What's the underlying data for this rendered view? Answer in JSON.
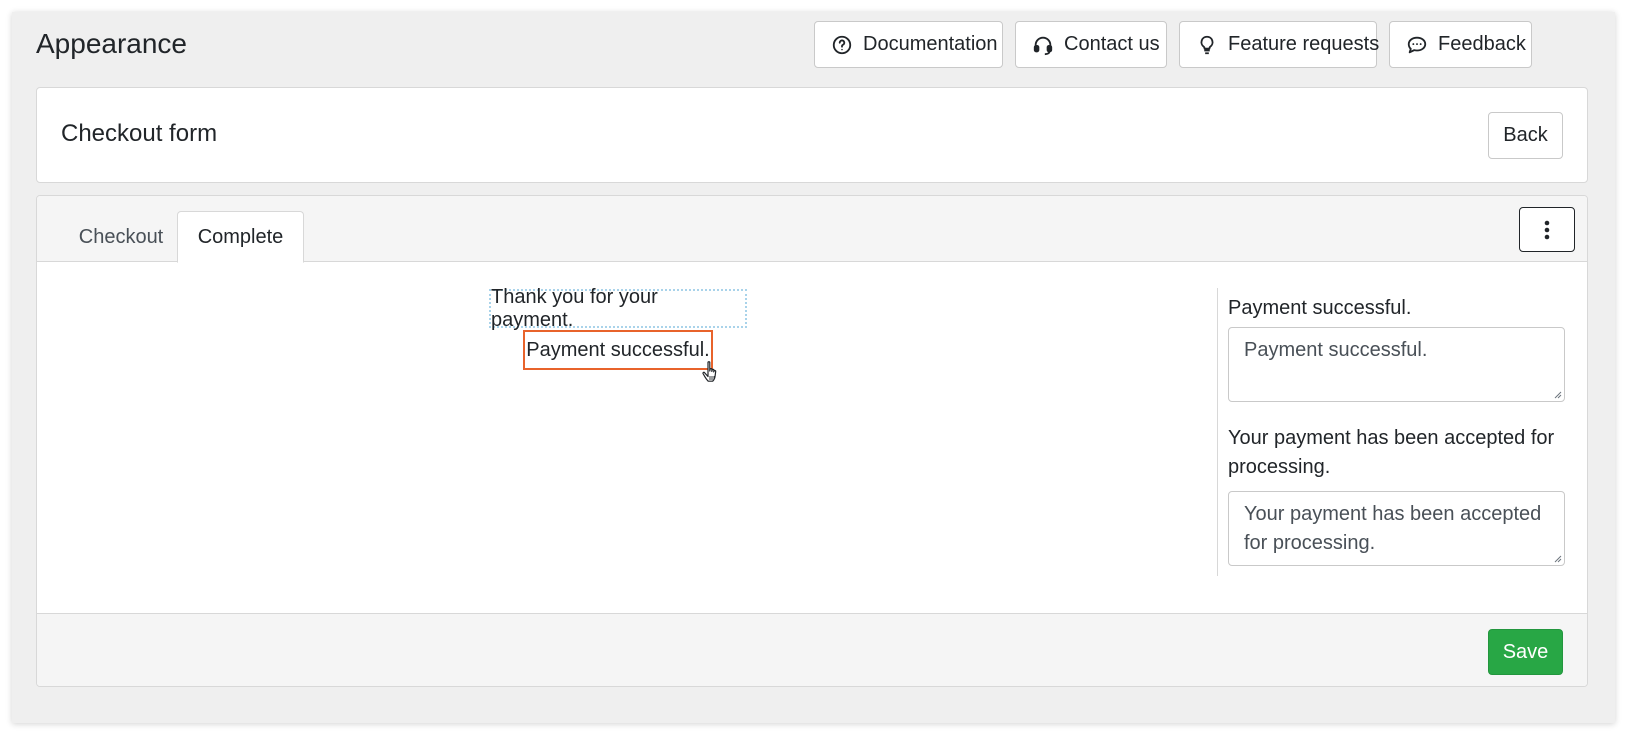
{
  "header": {
    "title": "Appearance",
    "buttons": {
      "documentation": "Documentation",
      "contact": "Contact us",
      "feature_requests": "Feature requests",
      "feedback": "Feedback"
    }
  },
  "card": {
    "title": "Checkout form",
    "back_label": "Back"
  },
  "tabs": [
    {
      "label": "Checkout",
      "active": false
    },
    {
      "label": "Complete",
      "active": true
    }
  ],
  "preview": {
    "thanks_text": "Thank you for your payment.",
    "success_text": "Payment successful."
  },
  "sidebar": {
    "field1_label": "Payment successful.",
    "field1_value": "Payment successful.",
    "field2_label": "Your payment has been accepted for processing.",
    "field2_value": "Your payment has been accepted for processing."
  },
  "footer": {
    "save_label": "Save"
  },
  "colors": {
    "save": "#28a745",
    "selected_outline": "#e8632b",
    "hover_outline": "#a9d3ea"
  },
  "icons": {
    "documentation": "question-circle-icon",
    "contact": "headset-icon",
    "feature_requests": "lightbulb-icon",
    "feedback": "chat-bubble-icon",
    "menu": "vertical-ellipsis-icon"
  }
}
